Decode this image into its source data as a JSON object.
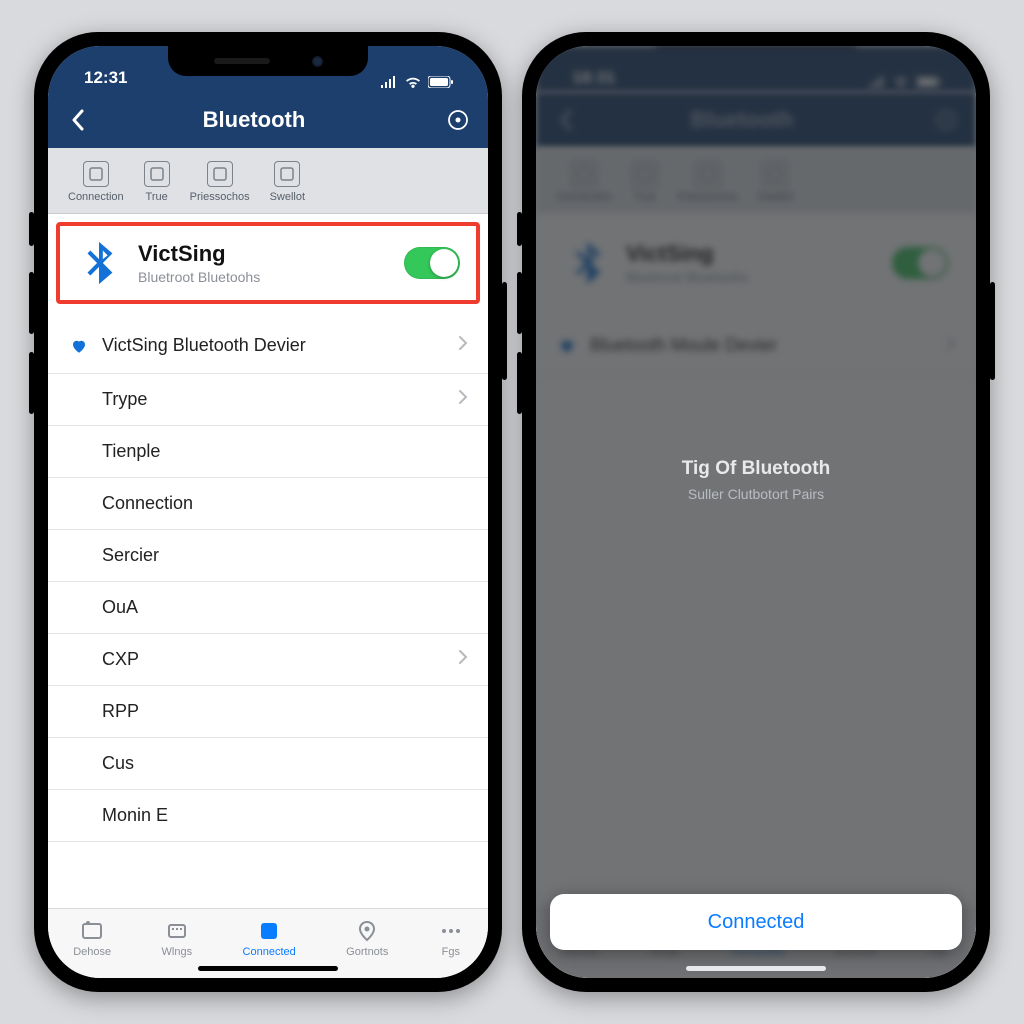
{
  "left": {
    "status_time": "12:31",
    "header_title": "Bluetooth",
    "toolbar": [
      {
        "label": "Connection",
        "name": "toolbar-connection"
      },
      {
        "label": "True",
        "name": "toolbar-true"
      },
      {
        "label": "Priessochos",
        "name": "toolbar-priessochos"
      },
      {
        "label": "Swellot",
        "name": "toolbar-swellot"
      }
    ],
    "highlight": {
      "name": "VictSing",
      "subtitle": "Bluetroot Bluetoohs",
      "toggle_on": true
    },
    "device_row": {
      "label": "VictSing Bluetooth Devier"
    },
    "rows": [
      {
        "label": "Trype",
        "chevron": true
      },
      {
        "label": "Tienple",
        "chevron": false
      },
      {
        "label": "Connection",
        "chevron": false
      },
      {
        "label": "Sercier",
        "chevron": false
      },
      {
        "label": "OuA",
        "chevron": false
      },
      {
        "label": "CXP",
        "chevron": true
      },
      {
        "label": "RPP",
        "chevron": false
      },
      {
        "label": "Cus",
        "chevron": false
      },
      {
        "label": "Monin  E",
        "chevron": false
      }
    ],
    "tabs": [
      {
        "label": "Dehose",
        "name": "tab-dehose"
      },
      {
        "label": "Wlngs",
        "name": "tab-wings"
      },
      {
        "label": "Connected",
        "name": "tab-connected"
      },
      {
        "label": "Gortnots",
        "name": "tab-gortnots"
      },
      {
        "label": "Fgs",
        "name": "tab-fgs"
      }
    ],
    "active_tab_index": 2
  },
  "right": {
    "status_time": "18:31",
    "header_title": "Bluetooth",
    "highlight": {
      "name": "VictSing",
      "subtitle": "Bluetroot Bluetoohs",
      "toggle_on": true
    },
    "device_row": {
      "label": "Bluetooth Moule Devier"
    },
    "overlay_title": "Tig Of Bluetooth",
    "overlay_subtitle": "Suller Clutbotort Pairs",
    "sheet_label": "Connected"
  },
  "colors": {
    "header_bg": "#1c3f6e",
    "highlight_border": "#ef3c2e",
    "accent": "#0a7cff",
    "toggle_on": "#34c759"
  }
}
